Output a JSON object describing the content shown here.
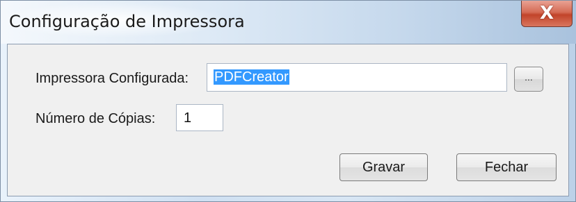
{
  "window": {
    "title": "Configuração de Impressora",
    "close_glyph": "X"
  },
  "form": {
    "printer_label": "Impressora Configurada:",
    "printer_value": "PDFCreator",
    "browse_label": "...",
    "copies_label": "Número de Cópias:",
    "copies_value": "1"
  },
  "buttons": {
    "save_label": "Gravar",
    "close_label": "Fechar"
  },
  "icons": {
    "close": "close-icon"
  }
}
